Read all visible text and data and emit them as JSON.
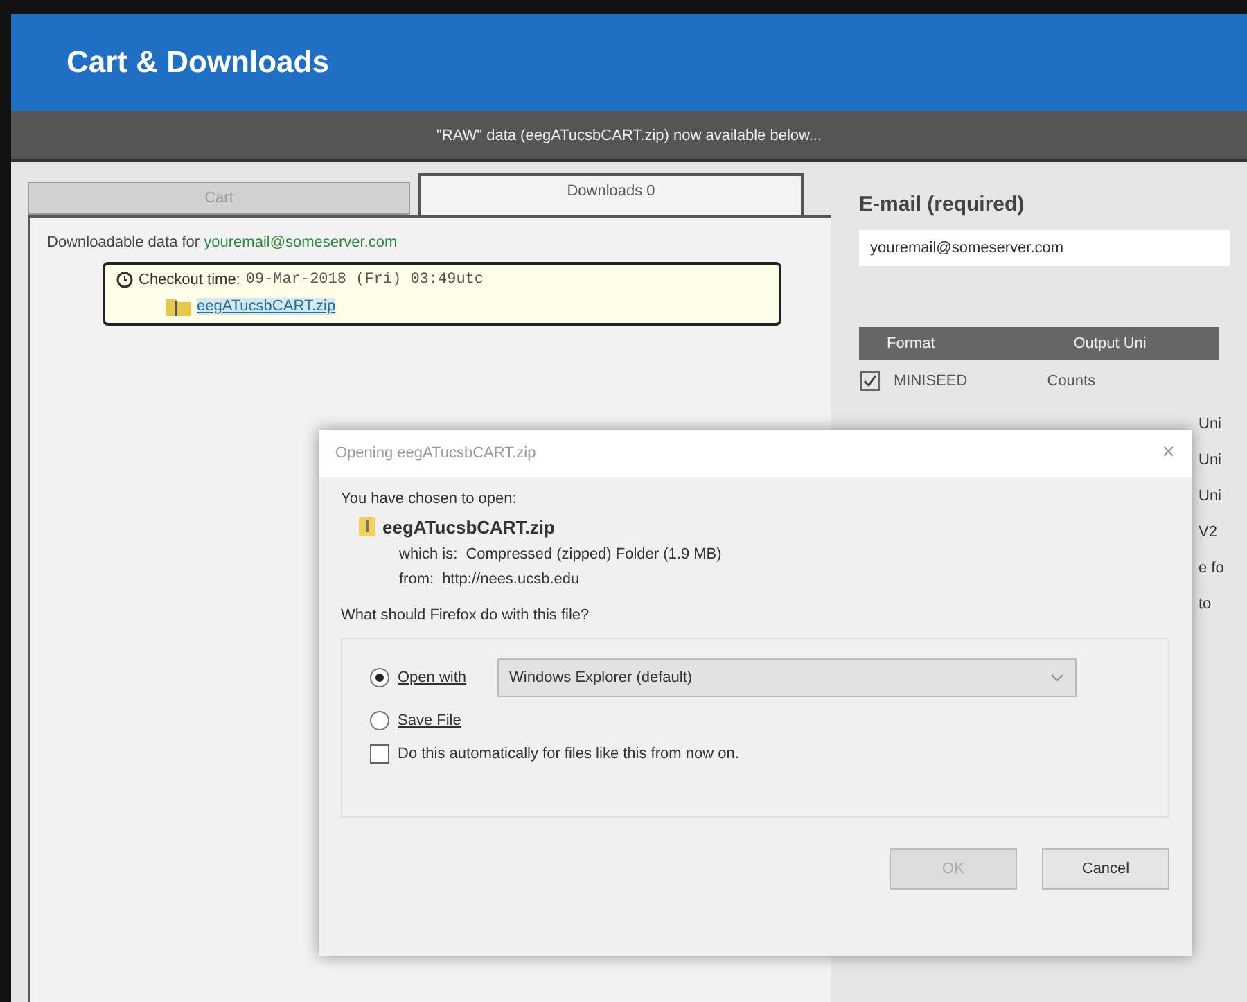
{
  "header": {
    "title": "Cart & Downloads"
  },
  "notice": "\"RAW\" data (eegATucsbCART.zip) now available below...",
  "tabs": [
    {
      "label": "Cart",
      "selected": false
    },
    {
      "label": "Downloads 0",
      "selected": true
    }
  ],
  "downloads": {
    "intro": "Downloadable data for",
    "email": "youremail@someserver.com",
    "checkout_label": "Checkout time:",
    "checkout_time": "09-Mar-2018 (Fri) 03:49utc",
    "file": "eegATucsbCART.zip"
  },
  "email_section": {
    "label": "E-mail (required)",
    "value": "youremail@someserver.com"
  },
  "format_table": {
    "columns": [
      "Format",
      "Output Uni"
    ],
    "rows": [
      {
        "checked": true,
        "cells": [
          "MINISEED",
          "Counts"
        ]
      }
    ]
  },
  "right_fragments": [
    "Uni",
    "Uni",
    "Uni",
    "V2",
    "e fo",
    "to"
  ],
  "dialog": {
    "title": "Opening eegATucsbCART.zip",
    "close": "×",
    "intro": "You have chosen to open:",
    "file": "eegATucsbCART.zip",
    "type_label": "which is:",
    "type": "Compressed (zipped) Folder (1.9 MB)",
    "from_label": "from:",
    "from": "http://nees.ucsb.edu",
    "question": "What should Firefox do with this file?",
    "options": [
      {
        "kind": "open",
        "label": "Open with",
        "selected": true
      },
      {
        "kind": "save",
        "label": "Save File",
        "selected": false
      }
    ],
    "app": "Windows Explorer (default)",
    "auto": {
      "label": "Do this automatically for files like this from now on.",
      "checked": false
    },
    "buttons": [
      {
        "label": "OK",
        "disabled": true
      },
      {
        "label": "Cancel",
        "disabled": false
      }
    ]
  }
}
